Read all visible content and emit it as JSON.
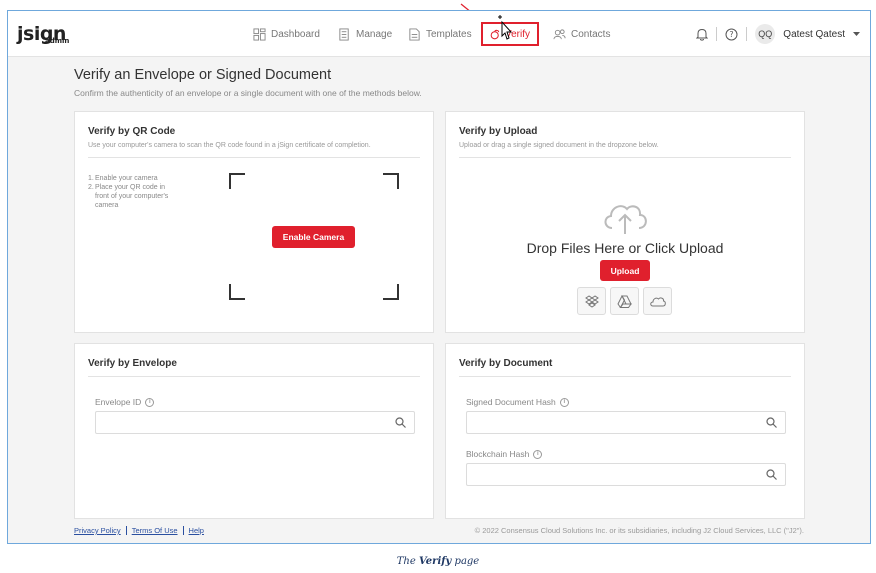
{
  "app": {
    "logo_main": "jsign",
    "logo_sub": "admin"
  },
  "nav": {
    "dashboard": "Dashboard",
    "manage": "Manage",
    "templates": "Templates",
    "verify": "Verify",
    "contacts": "Contacts"
  },
  "user": {
    "initials": "QQ",
    "name": "Qatest Qatest"
  },
  "page": {
    "title": "Verify an Envelope or Signed Document",
    "subtitle": "Confirm the authenticity of an envelope or a single document with one of the methods below."
  },
  "qr": {
    "title": "Verify by QR Code",
    "desc": "Use your computer's camera to scan the QR code found in a jSign certificate of completion.",
    "steps": [
      "Enable your camera",
      "Place your QR code in front of your computer's camera"
    ],
    "button": "Enable Camera"
  },
  "upload": {
    "title": "Verify by Upload",
    "desc": "Upload or drag a single signed document in the dropzone below.",
    "drop_text": "Drop Files Here or Click Upload",
    "button": "Upload",
    "sources": [
      "dropbox-icon",
      "google-drive-icon",
      "onedrive-icon"
    ]
  },
  "envelope": {
    "title": "Verify by Envelope",
    "field_label": "Envelope ID",
    "field_value": ""
  },
  "document": {
    "title": "Verify by Document",
    "hash_label": "Signed Document Hash",
    "hash_value": "",
    "blockchain_label": "Blockchain Hash",
    "blockchain_value": ""
  },
  "footer": {
    "privacy": "Privacy Policy",
    "terms": "Terms Of Use",
    "help": "Help",
    "copyright": "© 2022 Consensus Cloud Solutions Inc. or its subsidiaries, including J2 Cloud Services, LLC (\"J2\")."
  },
  "caption": {
    "prefix": "The ",
    "bold": "Verify",
    "suffix": " page"
  },
  "colors": {
    "accent": "#e0202d",
    "link": "#2a4fa0",
    "frame_border": "#6fa8dc"
  }
}
